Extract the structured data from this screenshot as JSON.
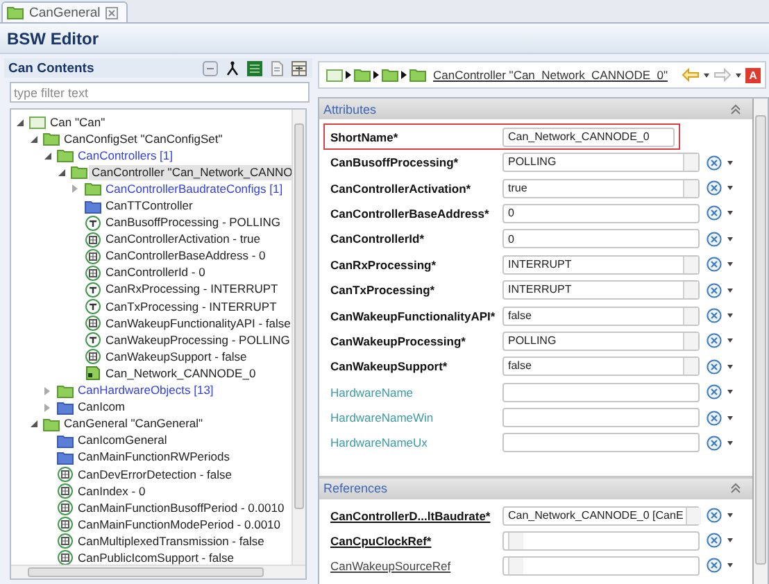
{
  "tab": {
    "label": "CanGeneral"
  },
  "editor_title": "BSW Editor",
  "contents": {
    "title": "Can Contents",
    "filter": {
      "placeholder": "type filter text"
    },
    "tree": [
      {
        "label": "Can \"Can\"",
        "kind": "module",
        "expanded": true,
        "selected": false,
        "multiple": false,
        "children": [
          {
            "label": "CanConfigSet \"CanConfigSet\"",
            "kind": "folder",
            "expanded": true,
            "selected": false,
            "multiple": false,
            "children": [
              {
                "label": "CanControllers [1]",
                "kind": "folder",
                "expanded": true,
                "selected": false,
                "multiple": true,
                "children": [
                  {
                    "label": "CanController \"Can_Network_CANNO",
                    "kind": "folder",
                    "expanded": true,
                    "selected": true,
                    "multiple": false,
                    "children": [
                      {
                        "label": "CanControllerBaudrateConfigs [1]",
                        "kind": "folder",
                        "expanded": false,
                        "selected": false,
                        "multiple": true
                      },
                      {
                        "label": "CanTTController",
                        "kind": "container",
                        "selected": false,
                        "multiple": false
                      },
                      {
                        "label": "CanBusoffProcessing - POLLING",
                        "kind": "text-param",
                        "selected": false,
                        "multiple": false
                      },
                      {
                        "label": "CanControllerActivation - true",
                        "kind": "value-param",
                        "selected": false,
                        "multiple": false
                      },
                      {
                        "label": "CanControllerBaseAddress - 0",
                        "kind": "value-param",
                        "selected": false,
                        "multiple": false
                      },
                      {
                        "label": "CanControllerId - 0",
                        "kind": "value-param",
                        "selected": false,
                        "multiple": false
                      },
                      {
                        "label": "CanRxProcessing - INTERRUPT",
                        "kind": "text-param",
                        "selected": false,
                        "multiple": false
                      },
                      {
                        "label": "CanTxProcessing - INTERRUPT",
                        "kind": "text-param",
                        "selected": false,
                        "multiple": false
                      },
                      {
                        "label": "CanWakeupFunctionalityAPI - false",
                        "kind": "value-param",
                        "selected": false,
                        "multiple": false
                      },
                      {
                        "label": "CanWakeupProcessing - POLLING",
                        "kind": "text-param",
                        "selected": false,
                        "multiple": false
                      },
                      {
                        "label": "CanWakeupSupport - false",
                        "kind": "value-param",
                        "selected": false,
                        "multiple": false
                      },
                      {
                        "label": "Can_Network_CANNODE_0",
                        "kind": "reference",
                        "selected": false,
                        "multiple": false
                      }
                    ]
                  }
                ]
              },
              {
                "label": "CanHardwareObjects [13]",
                "kind": "folder",
                "expanded": false,
                "selected": false,
                "multiple": true
              },
              {
                "label": "CanIcom",
                "kind": "container",
                "expanded": false,
                "selected": false,
                "multiple": false
              }
            ]
          },
          {
            "label": "CanGeneral \"CanGeneral\"",
            "kind": "folder",
            "expanded": true,
            "selected": false,
            "multiple": false,
            "children": [
              {
                "label": "CanIcomGeneral",
                "kind": "container",
                "selected": false,
                "multiple": false
              },
              {
                "label": "CanMainFunctionRWPeriods",
                "kind": "container",
                "selected": false,
                "multiple": false
              },
              {
                "label": "CanDevErrorDetection - false",
                "kind": "value-param",
                "selected": false,
                "multiple": false
              },
              {
                "label": "CanIndex - 0",
                "kind": "value-param",
                "selected": false,
                "multiple": false
              },
              {
                "label": "CanMainFunctionBusoffPeriod - 0.0010",
                "kind": "value-param",
                "selected": false,
                "multiple": false
              },
              {
                "label": "CanMainFunctionModePeriod - 0.0010",
                "kind": "value-param",
                "selected": false,
                "multiple": false
              },
              {
                "label": "CanMultiplexedTransmission - false",
                "kind": "value-param",
                "selected": false,
                "multiple": false
              },
              {
                "label": "CanPublicIcomSupport - false",
                "kind": "value-param",
                "selected": false,
                "multiple": false
              }
            ]
          }
        ]
      }
    ]
  },
  "breadcrumb": {
    "link": "CanController \"Can_Network_CANNODE_0\"",
    "badge": "A"
  },
  "attributes": {
    "title": "Attributes",
    "rows": [
      {
        "label": "ShortName*",
        "kind": "name",
        "value": "Can_Network_CANNODE_0",
        "required": true,
        "highlighted": true
      },
      {
        "label": "CanBusoffProcessing*",
        "kind": "combo",
        "value": "POLLING",
        "required": true,
        "highlighted": false
      },
      {
        "label": "CanControllerActivation*",
        "kind": "combo",
        "value": "true",
        "required": true,
        "highlighted": false
      },
      {
        "label": "CanControllerBaseAddress*",
        "kind": "text",
        "value": "0",
        "required": true,
        "highlighted": false
      },
      {
        "label": "CanControllerId*",
        "kind": "text",
        "value": "0",
        "required": true,
        "highlighted": false
      },
      {
        "label": "CanRxProcessing*",
        "kind": "combo",
        "value": "INTERRUPT",
        "required": true,
        "highlighted": false
      },
      {
        "label": "CanTxProcessing*",
        "kind": "combo",
        "value": "INTERRUPT",
        "required": true,
        "highlighted": false
      },
      {
        "label": "CanWakeupFunctionalityAPI*",
        "kind": "combo",
        "value": "false",
        "required": true,
        "highlighted": false
      },
      {
        "label": "CanWakeupProcessing*",
        "kind": "combo",
        "value": "POLLING",
        "required": true,
        "highlighted": false
      },
      {
        "label": "CanWakeupSupport*",
        "kind": "combo",
        "value": "false",
        "required": true,
        "highlighted": false
      },
      {
        "label": "HardwareName",
        "kind": "text",
        "required": false,
        "highlighted": false
      },
      {
        "label": "HardwareNameWin",
        "kind": "text",
        "required": false,
        "highlighted": false
      },
      {
        "label": "HardwareNameUx",
        "kind": "text",
        "required": false,
        "highlighted": false
      }
    ]
  },
  "references": {
    "title": "References",
    "rows": [
      {
        "label": "CanControllerD...ltBaudrate*",
        "kind": "combo",
        "value": "Can_Network_CANNODE_0 [CanE",
        "required": true
      },
      {
        "label": "CanCpuClockRef*",
        "kind": "combo",
        "required": true
      },
      {
        "label": "CanWakeupSourceRef",
        "kind": "combo",
        "required": false
      }
    ]
  }
}
